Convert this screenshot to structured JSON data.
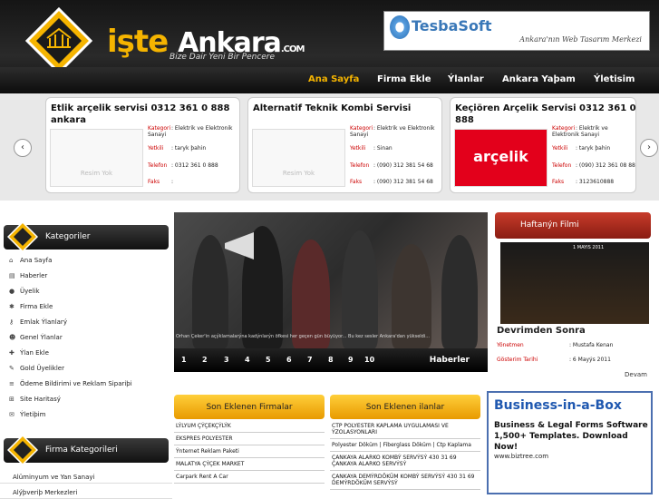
{
  "header": {
    "logo_main": "işte",
    "logo_word": "Ankara",
    "logo_com": ".COM",
    "slogan": "Bize Dair Yeni Bir Pencere",
    "banner": {
      "brand": "TesbaSoft",
      "tagline": "Ankara'nın Web Tasarım Merkezi"
    }
  },
  "nav": {
    "items": [
      "Ana Sayfa",
      "Firma Ekle",
      "Ýlanlar",
      "Ankara Yaþam",
      "Ýletisim"
    ]
  },
  "strip": {
    "left_arrow": "‹",
    "right_arrow": "›",
    "cards": [
      {
        "title": "Etlik arçelik servisi 0312 361 0 888 ankara",
        "image_text": "Resim Yok",
        "rows": [
          {
            "k": "Kategori",
            "v": ": Elektrik ve Elektronik Sanayi"
          },
          {
            "k": "Yetkili",
            "v": ": taryk þahin"
          },
          {
            "k": "Telefon",
            "v": ": 0312 361 0 888"
          },
          {
            "k": "Faks",
            "v": ":"
          }
        ]
      },
      {
        "title": "Alternatif Teknik Kombi Servisi",
        "image_text": "Resim Yok",
        "rows": [
          {
            "k": "Kategori",
            "v": ": Elektrik ve Elektronik Sanayi"
          },
          {
            "k": "Yetkili",
            "v": ": Sinan"
          },
          {
            "k": "Telefon",
            "v": ": (090) 312 381 54 68"
          },
          {
            "k": "Faks",
            "v": ": (090) 312 381 54 68"
          }
        ]
      },
      {
        "title": "Keçiören Arçelik Servisi 0312 361 0 888",
        "image_text": "arçelik",
        "rows": [
          {
            "k": "Kategori",
            "v": ": Elektrik ve Elektronik Sanayi"
          },
          {
            "k": "Yetkili",
            "v": ": taryk þahin"
          },
          {
            "k": "Telefon",
            "v": ": (090) 312 361 08 88"
          },
          {
            "k": "Faks",
            "v": ": 3123610888"
          }
        ]
      }
    ]
  },
  "sidebar": {
    "title": "Kategoriler",
    "items": [
      "Ana Sayfa",
      "Haberler",
      "Üyelik",
      "Firma Ekle",
      "Emlak Ýlanlarý",
      "Genel Ýlanlar",
      "Ýlan Ekle",
      "Gold Üyelikler",
      "Ödeme Bildirimi ve Reklam Sipariþi",
      "Site Haritasý",
      "Ýletiþim"
    ],
    "cat_title": "Firma Kategorileri",
    "cats": [
      "Alüminyum ve Yan Sanayi",
      "Alýþveriþ Merkezleri"
    ]
  },
  "slider": {
    "caption": "Orhan Çeker'in açýklamalarýna kadýnlarýn öfkesi her geçen gün büyüyor... Bu kez sesler Ankara'dan yükseldi...",
    "numbers": [
      "1",
      "2",
      "3",
      "4",
      "5",
      "6",
      "7",
      "8",
      "9",
      "10"
    ],
    "label": "Haberler"
  },
  "film": {
    "head": "Haftanýn Filmi",
    "poster_text": "1 MAYIS 2011",
    "title": "Devrimden Sonra",
    "rows": [
      {
        "k": "Yönetmen",
        "v": ": Mustafa Kenan"
      },
      {
        "k": "Gösterim Tarihi",
        "v": ": 6 Mayýs 2011"
      }
    ],
    "more": "Devam"
  },
  "firms": {
    "head": "Son Eklenen Firmalar",
    "items": [
      "LÝLYUM ÇÝÇEKÇÝLÝK",
      "EKSPRES POLYESTER",
      "Ýnternet Reklam Paketi",
      "MALATYA ÇÝÇEK MARKET",
      "Carpark Rent A Car"
    ]
  },
  "ads": {
    "head": "Son Eklenen ilanlar",
    "items": [
      "CTP POLYESTER KAPLAMA UYGULAMASI VE ÝZOLASYONLARI",
      "Polyester Döküm | Fiberglass Döküm | Ctp Kaplama",
      "ÇANKAYA ALARKO KOMBÝ SERVÝSÝ 430 31 69 ÇANKAYA ALARKO SERVÝSÝ",
      "ÇANKAYA DEMÝRDÖKÜM KOMBÝ SERVÝSÝ 430 31 69 DEMÝRDÖKÜM SERVÝSÝ"
    ]
  },
  "biz": {
    "title": "Business-in-a-Box",
    "sub": "Business & Legal Forms Software 1,500+ Templates. Download Now!",
    "url": "www.biztree.com"
  }
}
